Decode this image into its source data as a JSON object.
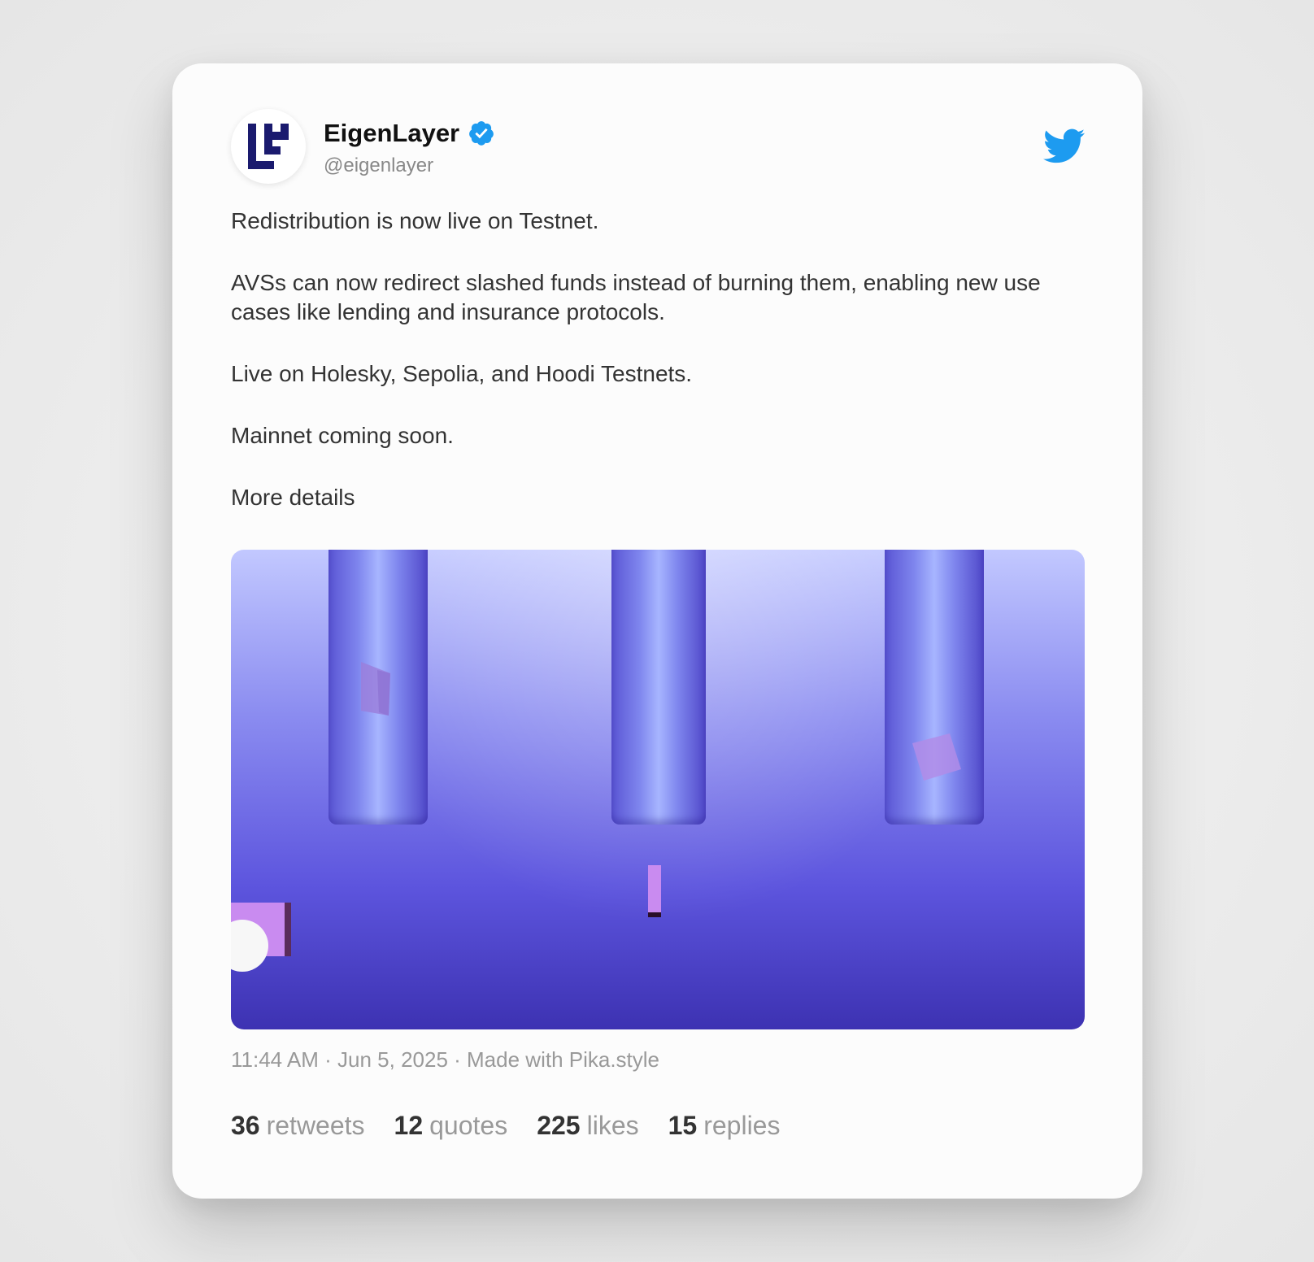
{
  "tweet": {
    "author": {
      "name": "EigenLayer",
      "handle": "@eigenlayer",
      "verified": true
    },
    "body": [
      "Redistribution is now live on Testnet.",
      "AVSs can now redirect slashed funds instead of burning them, enabling new use cases like lending and insurance protocols.",
      "Live on Holesky, Sepolia, and Hoodi Testnets.",
      "Mainnet coming soon.",
      "More details"
    ],
    "meta": "11:44 AM · Jun 5, 2025 · Made with Pika.style",
    "stats": [
      {
        "count": "36",
        "label": "retweets"
      },
      {
        "count": "12",
        "label": "quotes"
      },
      {
        "count": "225",
        "label": "likes"
      },
      {
        "count": "15",
        "label": "replies"
      }
    ]
  },
  "colors": {
    "twitter_blue": "#1d9bf0",
    "verified_blue": "#1d9bf0",
    "logo_navy": "#1a1a6e"
  },
  "icons": [
    "eigenlayer-logo-icon",
    "verified-badge-icon",
    "twitter-bird-icon"
  ]
}
